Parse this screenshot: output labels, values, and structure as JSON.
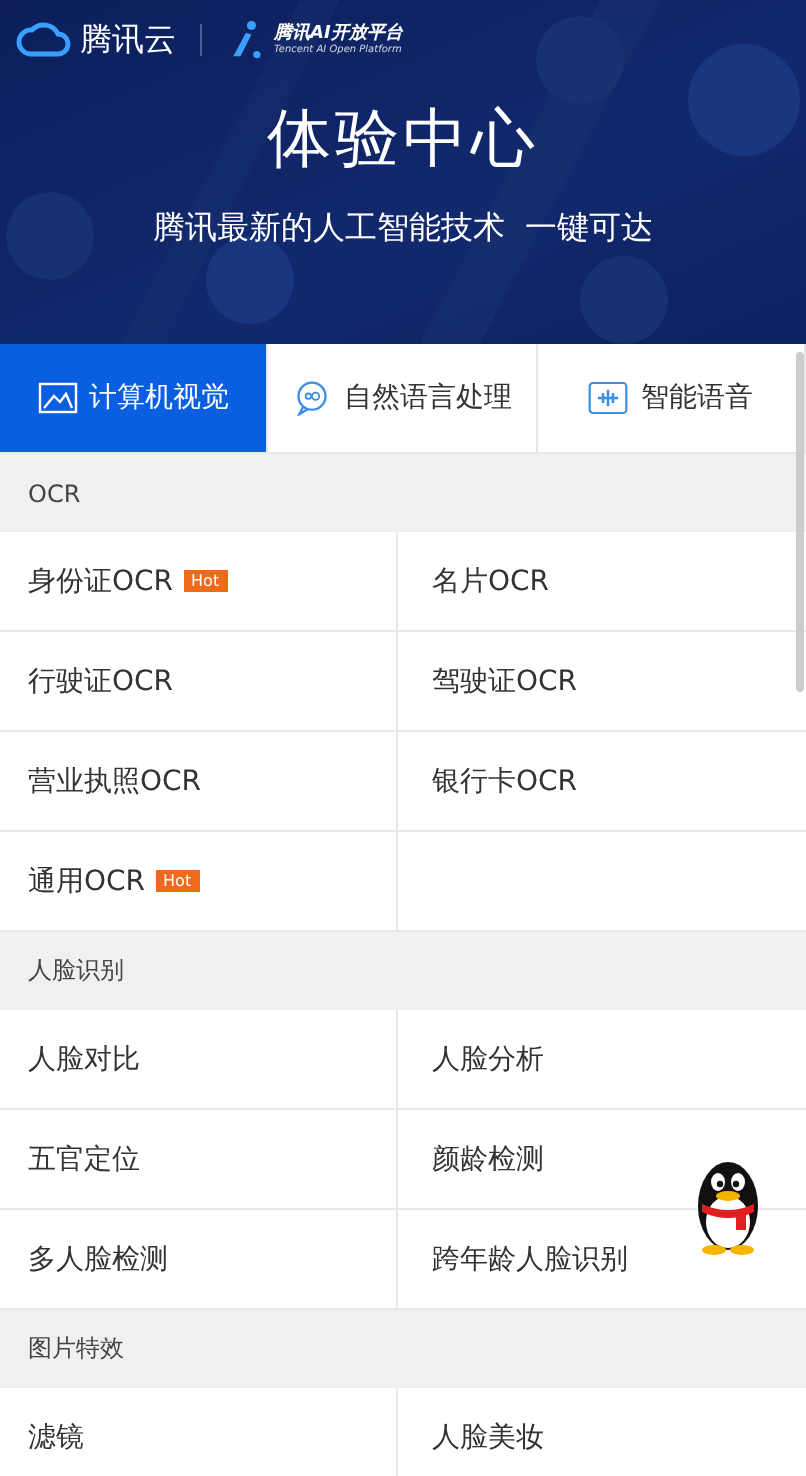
{
  "header": {
    "brand": "腾讯云",
    "platform_name": "腾讯AI开放平台",
    "platform_subtitle": "Tencent AI Open Platform",
    "title": "体验中心",
    "subtitle": "腾讯最新的人工智能技术  一键可达"
  },
  "tabs": [
    {
      "label": "计算机视觉",
      "kind": "image",
      "selected": true
    },
    {
      "label": "自然语言处理",
      "kind": "chat",
      "selected": false
    },
    {
      "label": "智能语音",
      "kind": "voice",
      "selected": false
    }
  ],
  "sections": [
    {
      "title": "OCR",
      "items": [
        {
          "label": "身份证OCR",
          "badge": "Hot"
        },
        {
          "label": "名片OCR"
        },
        {
          "label": "行驶证OCR"
        },
        {
          "label": "驾驶证OCR"
        },
        {
          "label": "营业执照OCR"
        },
        {
          "label": "银行卡OCR"
        },
        {
          "label": "通用OCR",
          "badge": "Hot"
        }
      ]
    },
    {
      "title": "人脸识别",
      "items": [
        {
          "label": "人脸对比"
        },
        {
          "label": "人脸分析"
        },
        {
          "label": "五官定位"
        },
        {
          "label": "颜龄检测"
        },
        {
          "label": "多人脸检测"
        },
        {
          "label": "跨年龄人脸识别"
        }
      ]
    },
    {
      "title": "图片特效",
      "items": [
        {
          "label": "滤镜"
        },
        {
          "label": "人脸美妆"
        }
      ]
    }
  ]
}
